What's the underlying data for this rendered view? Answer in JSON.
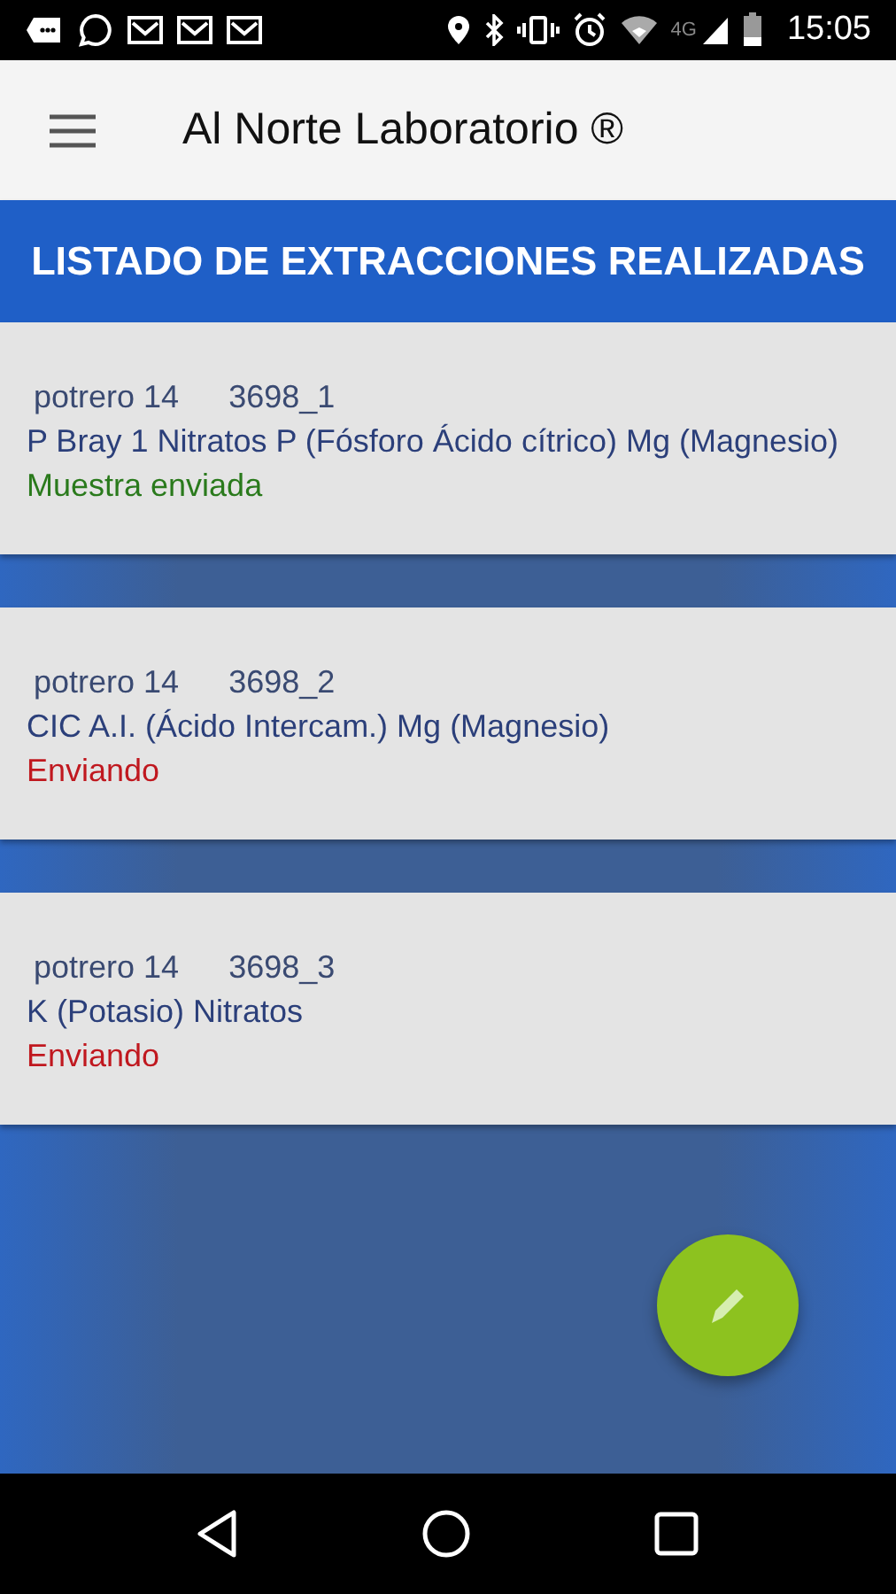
{
  "status_bar": {
    "network": "4G",
    "time": "15:05"
  },
  "app_bar": {
    "title": "Al Norte Laboratorio ®"
  },
  "header": "LISTADO DE EXTRACCIONES REALIZADAS",
  "samples": [
    {
      "field": "potrero 14",
      "code": "3698_1",
      "analyses": "P Bray 1 Nitratos P (Fósforo Ácido cítrico) Mg (Magnesio)",
      "status": "Muestra enviada",
      "kind": "sent"
    },
    {
      "field": "potrero 14",
      "code": "3698_2",
      "analyses": "CIC A.I. (Ácido Intercam.) Mg (Magnesio)",
      "status": "Enviando",
      "kind": "sending"
    },
    {
      "field": "potrero 14",
      "code": "3698_3",
      "analyses": "K (Potasio) Nitratos",
      "status": "Enviando",
      "kind": "sending"
    }
  ]
}
